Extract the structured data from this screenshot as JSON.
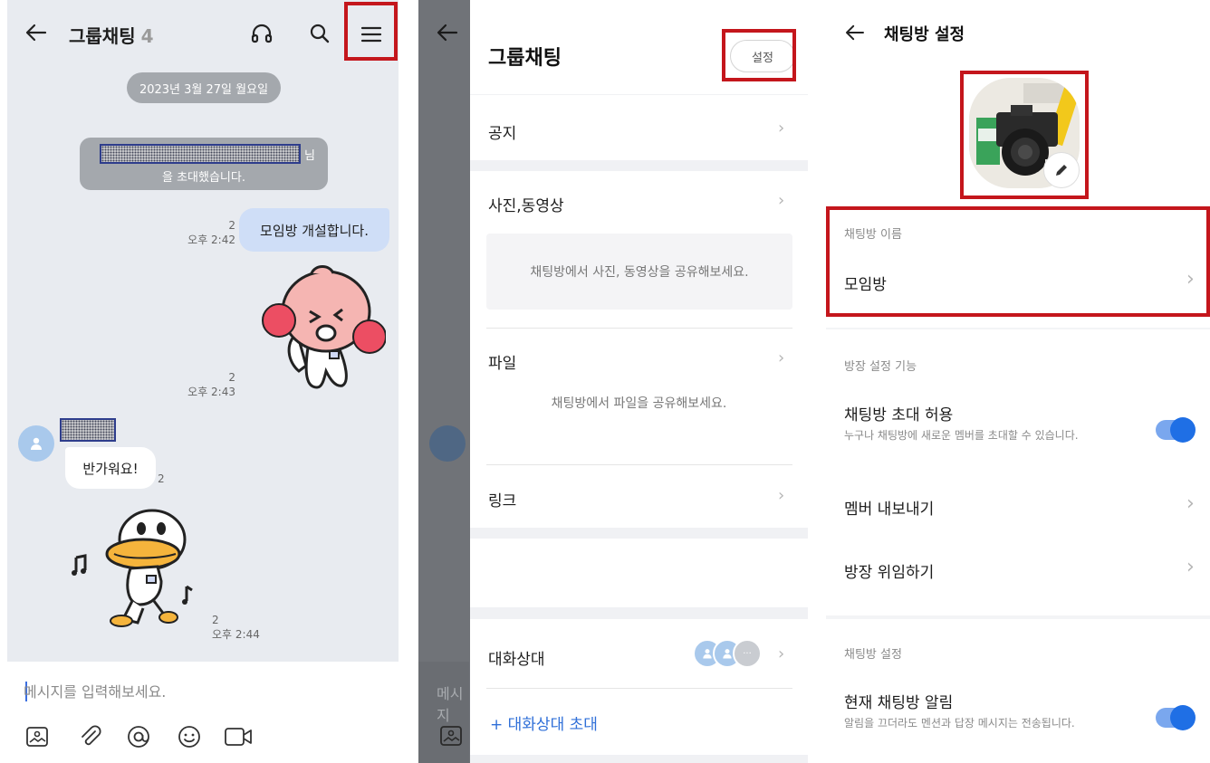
{
  "chat": {
    "title": "그룹채팅",
    "member_count": "4",
    "date": "2023년 3월 27일 월요일",
    "invite_suffix": "님",
    "invite_line2": "을 초대했습니다.",
    "messages": [
      {
        "unread": "2",
        "time": "오후 2:42",
        "text": "모임방 개설합니다."
      },
      {
        "unread": "2",
        "time": "오후 2:43"
      },
      {
        "text": "반가워요!",
        "unread": "2"
      },
      {
        "unread": "2",
        "time": "오후 2:44"
      }
    ],
    "input_placeholder": "메시지를 입력해보세요."
  },
  "drawer": {
    "title": "그룹채팅",
    "settings_label": "설정",
    "notice_label": "공지",
    "media_label": "사진,동영상",
    "media_empty": "채팅방에서 사진, 동영상을 공유해보세요.",
    "file_label": "파일",
    "file_empty": "채팅방에서 파일을 공유해보세요.",
    "link_label": "링크",
    "members_label": "대화상대",
    "more_members": "···",
    "invite_label": "+ 대화상대 초대",
    "ghost_input": "메시지"
  },
  "settings": {
    "title": "채팅방 설정",
    "name_label": "채팅방 이름",
    "name_value": "모임방",
    "owner_section": "방장 설정 기능",
    "allow_invite_title": "채팅방 초대 허용",
    "allow_invite_desc": "누구나 채팅방에 새로운 멤버를 초대할 수 있습니다.",
    "kick_member": "멤버 내보내기",
    "delegate_owner": "방장 위임하기",
    "room_section": "채팅방 설정",
    "notify_title": "현재 채팅방 알림",
    "notify_desc": "알림을 끄더라도 멘션과 답장 메시지는 전송됩니다."
  },
  "colors": {
    "highlight": "#c4161c",
    "accent": "#1f6fe5",
    "link": "#2f6fd8"
  }
}
